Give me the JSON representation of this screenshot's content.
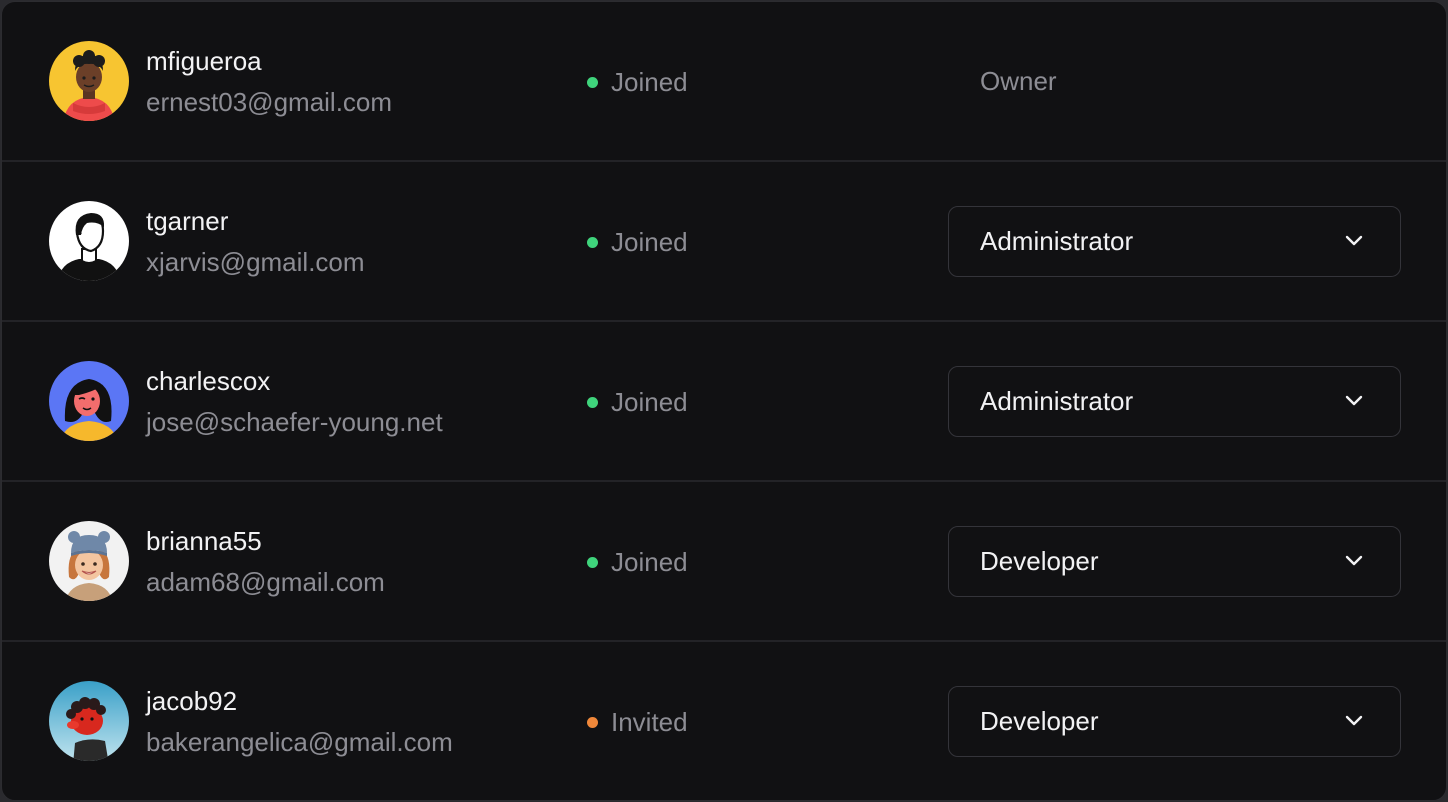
{
  "members": [
    {
      "username": "mfigueroa",
      "email": "ernest03@gmail.com",
      "status": "Joined",
      "status_color": "#3fd47c",
      "role": "Owner",
      "role_editable": false,
      "avatar_icon": "avatar-man-curly-hair-icon"
    },
    {
      "username": "tgarner",
      "email": "xjarvis@gmail.com",
      "status": "Joined",
      "status_color": "#3fd47c",
      "role": "Administrator",
      "role_editable": true,
      "avatar_icon": "avatar-man-silhouette-icon"
    },
    {
      "username": "charlescox",
      "email": "jose@schaefer-young.net",
      "status": "Joined",
      "status_color": "#3fd47c",
      "role": "Administrator",
      "role_editable": true,
      "avatar_icon": "avatar-woman-winking-icon"
    },
    {
      "username": "brianna55",
      "email": "adam68@gmail.com",
      "status": "Joined",
      "status_color": "#3fd47c",
      "role": "Developer",
      "role_editable": true,
      "avatar_icon": "avatar-girl-beanie-icon"
    },
    {
      "username": "jacob92",
      "email": "bakerangelica@gmail.com",
      "status": "Invited",
      "status_color": "#f0883a",
      "role": "Developer",
      "role_editable": true,
      "avatar_icon": "avatar-red-character-icon"
    }
  ],
  "colors": {
    "background": "#111113",
    "divider": "#232327",
    "text_primary": "#f2f2f4",
    "text_secondary": "#8d8d94"
  }
}
